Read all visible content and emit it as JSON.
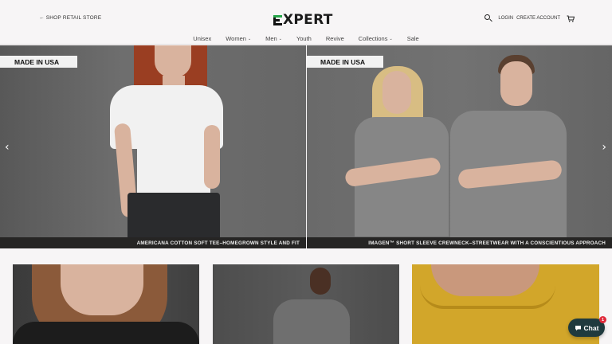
{
  "header": {
    "retail_link": "← SHOP RETAIL STORE",
    "logo_text": "XPERT",
    "login": "LOGIN",
    "create_account": "CREATE ACCOUNT"
  },
  "nav": {
    "items": [
      {
        "label": "Unisex",
        "has_caret": false
      },
      {
        "label": "Women",
        "has_caret": true
      },
      {
        "label": "Men",
        "has_caret": true
      },
      {
        "label": "Youth",
        "has_caret": false
      },
      {
        "label": "Revive",
        "has_caret": false
      },
      {
        "label": "Collections",
        "has_caret": true
      },
      {
        "label": "Sale",
        "has_caret": false
      }
    ],
    "caret": "⌄"
  },
  "hero": {
    "left": {
      "badge": "MADE IN USA",
      "caption": "AMERICANA COTTON SOFT TEE–HOMEGROWN STYLE AND FIT"
    },
    "right": {
      "badge": "MADE IN USA",
      "caption": "IMAGEN™ SHORT SLEEVE CREWNECK–STREETWEAR WITH A CONSCIENTIOUS APPROACH"
    },
    "prev_arrow": "‹",
    "next_arrow": "›"
  },
  "chat": {
    "label": "Chat",
    "badge_count": "1"
  },
  "colors": {
    "brand_green": "#27a64a",
    "chat_bg": "#1f3a3e",
    "badge_red": "#e02a3a"
  }
}
